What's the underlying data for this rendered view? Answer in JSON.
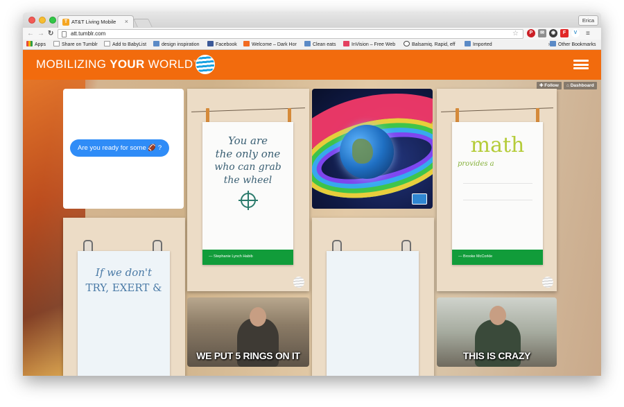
{
  "browser": {
    "tab_title": "AT&T Living Mobile",
    "tab_favicon": "T",
    "tab_close": "×",
    "user_name": "Erica",
    "url": "att.tumblr.com",
    "bookmarks": [
      {
        "label": "Apps",
        "icon": "apps-icon"
      },
      {
        "label": "Share on Tumblr",
        "icon": "page-icon"
      },
      {
        "label": "Add to BabyList",
        "icon": "page-icon"
      },
      {
        "label": "design inspiration",
        "icon": "folder-icon"
      },
      {
        "label": "Facebook",
        "icon": "facebook-icon"
      },
      {
        "label": "Welcome – Dark Hor",
        "icon": "orange-icon"
      },
      {
        "label": "Clean eats",
        "icon": "folder-icon"
      },
      {
        "label": "InVision – Free Web",
        "icon": "invision-icon"
      },
      {
        "label": "Balsamiq. Rapid, eff",
        "icon": "smile-icon"
      },
      {
        "label": "Imported",
        "icon": "folder-icon"
      }
    ],
    "bookmarks_overflow": "»",
    "other_bookmarks": "Other Bookmarks",
    "extensions": [
      "pinterest",
      "mail",
      "chrome",
      "flipboard",
      "venmo"
    ]
  },
  "site": {
    "brand_light": "MOBILIZING ",
    "brand_bold": "YOUR",
    "brand_light_2": " WORLD",
    "brand_mark": "™",
    "follow_label": "✚ Follow",
    "dashboard_label": "⌂ Dashboard",
    "accent_color": "#f26b0d"
  },
  "posts": {
    "message_text": "Are you ready for some 🏈 ?",
    "quote1_line1": "You are",
    "quote1_line2": "the only one",
    "quote1_line3": "who can grab",
    "quote1_line4": "the wheel",
    "quote1_author": "— Stephanie Lynch Habib",
    "math_word": "math",
    "math_sub": "provides a",
    "math_author": "— Brooke McCorkle",
    "quote2_line1": "If we don't",
    "quote2_line2": "TRY, EXERT &",
    "gif1_caption": "WE PUT 5 RINGS ON IT",
    "gif2_caption": "THIS IS CRAZY"
  }
}
